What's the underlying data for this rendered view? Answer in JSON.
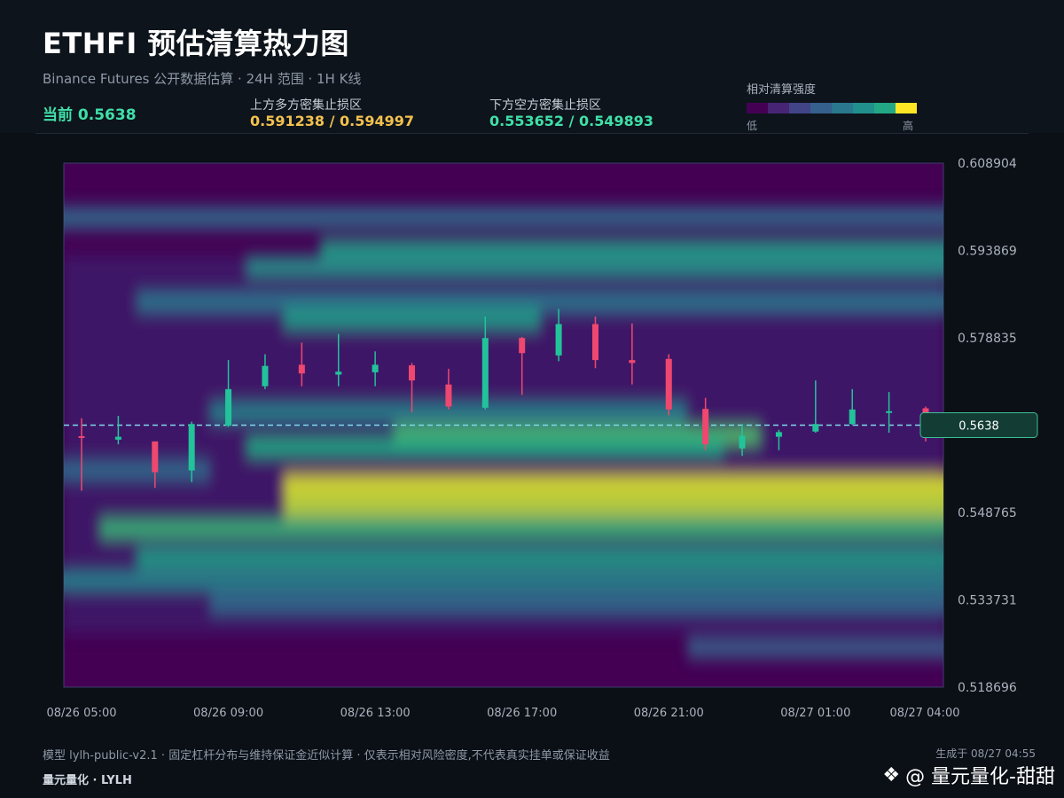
{
  "header": {
    "title": "ETHFI 预估清算热力图",
    "subtitle": "Binance Futures 公开数据估算 · 24H 范围 · 1H K线",
    "current_label": "当前",
    "current_value": "0.5638",
    "upper_zone_label": "上方多方密集止损区",
    "upper_zone_value": "0.591238 / 0.594997",
    "lower_zone_label": "下方空方密集止损区",
    "lower_zone_value": "0.553652 / 0.549893",
    "legend_title": "相对清算强度",
    "legend_low": "低",
    "legend_high": "高"
  },
  "colors": {
    "bullish": "#22c39a",
    "bearish": "#ef476f",
    "upper_zone": "#f2c14e",
    "lower_zone": "#3fe0a8",
    "legend": [
      "#440154",
      "#482475",
      "#414487",
      "#355f8d",
      "#2a788e",
      "#21908d",
      "#22a884",
      "#fde725"
    ]
  },
  "footer": {
    "note": "模型 lylh-public-v2.1 · 固定杠杆分布与维持保证金近似计算 · 仅表示相对风险密度,不代表真实挂单或保证收益",
    "brand": "量元量化 · LYLH",
    "generated": "生成于 08/27 04:55",
    "watermark": "@ 量元量化-甜甜"
  },
  "chart_data": {
    "type": "heatmap",
    "y_range": [
      0.518696,
      0.608904
    ],
    "y_ticks": [
      "0.608904",
      "0.593869",
      "0.578835",
      "0.563800",
      "0.548765",
      "0.533731",
      "0.518696"
    ],
    "x_ticks": [
      "08/26 05:00",
      "08/26 09:00",
      "08/26 13:00",
      "08/26 17:00",
      "08/26 21:00",
      "08/27 01:00",
      "08/27 04:00"
    ],
    "current_price": 0.5638,
    "current_price_label": "0.5638",
    "candles": [
      {
        "t": "08/26 05:00",
        "o": 0.5619,
        "h": 0.565,
        "l": 0.5525,
        "c": 0.5618
      },
      {
        "t": "08/26 06:00",
        "o": 0.5613,
        "h": 0.5654,
        "l": 0.5605,
        "c": 0.5618
      },
      {
        "t": "08/26 07:00",
        "o": 0.561,
        "h": 0.5608,
        "l": 0.553,
        "c": 0.5557
      },
      {
        "t": "08/26 08:00",
        "o": 0.556,
        "h": 0.5644,
        "l": 0.554,
        "c": 0.564
      },
      {
        "t": "08/26 09:00",
        "o": 0.5637,
        "h": 0.575,
        "l": 0.5635,
        "c": 0.57
      },
      {
        "t": "08/26 10:00",
        "o": 0.5705,
        "h": 0.576,
        "l": 0.57,
        "c": 0.574
      },
      {
        "t": "08/26 11:00",
        "o": 0.5742,
        "h": 0.578,
        "l": 0.5705,
        "c": 0.5727
      },
      {
        "t": "08/26 12:00",
        "o": 0.5725,
        "h": 0.5795,
        "l": 0.5705,
        "c": 0.573
      },
      {
        "t": "08/26 13:00",
        "o": 0.5729,
        "h": 0.5765,
        "l": 0.5705,
        "c": 0.5742
      },
      {
        "t": "08/26 14:00",
        "o": 0.5741,
        "h": 0.5745,
        "l": 0.566,
        "c": 0.5715
      },
      {
        "t": "08/26 15:00",
        "o": 0.5708,
        "h": 0.5735,
        "l": 0.5665,
        "c": 0.567
      },
      {
        "t": "08/26 16:00",
        "o": 0.5668,
        "h": 0.5825,
        "l": 0.5665,
        "c": 0.5788
      },
      {
        "t": "08/26 17:00",
        "o": 0.5788,
        "h": 0.579,
        "l": 0.569,
        "c": 0.5762
      },
      {
        "t": "08/26 18:00",
        "o": 0.5758,
        "h": 0.5838,
        "l": 0.5748,
        "c": 0.5812
      },
      {
        "t": "08/26 19:00",
        "o": 0.5812,
        "h": 0.5825,
        "l": 0.5736,
        "c": 0.575
      },
      {
        "t": "08/26 20:00",
        "o": 0.575,
        "h": 0.5813,
        "l": 0.5708,
        "c": 0.5745
      },
      {
        "t": "08/26 21:00",
        "o": 0.5752,
        "h": 0.576,
        "l": 0.5655,
        "c": 0.5665
      },
      {
        "t": "08/26 22:00",
        "o": 0.5666,
        "h": 0.5685,
        "l": 0.5595,
        "c": 0.5605
      },
      {
        "t": "08/26 23:00",
        "o": 0.5598,
        "h": 0.564,
        "l": 0.5585,
        "c": 0.562
      },
      {
        "t": "08/27 00:00",
        "o": 0.5618,
        "h": 0.563,
        "l": 0.5595,
        "c": 0.5626
      },
      {
        "t": "08/27 01:00",
        "o": 0.5627,
        "h": 0.5715,
        "l": 0.5625,
        "c": 0.564
      },
      {
        "t": "08/27 02:00",
        "o": 0.564,
        "h": 0.57,
        "l": 0.5638,
        "c": 0.5665
      },
      {
        "t": "08/27 03:00",
        "o": 0.566,
        "h": 0.5695,
        "l": 0.5625,
        "c": 0.5662
      },
      {
        "t": "08/27 04:00",
        "o": 0.5667,
        "h": 0.567,
        "l": 0.561,
        "c": 0.5638
      }
    ],
    "heat_bands": [
      {
        "price": 0.5995,
        "t_from": "08/26 05:00",
        "t_to": "08/27 04:00",
        "intensity": 0.35
      },
      {
        "price": 0.594,
        "t_from": "08/26 12:00",
        "t_to": "08/27 04:00",
        "intensity": 0.55
      },
      {
        "price": 0.591,
        "t_from": "08/26 10:00",
        "t_to": "08/27 04:00",
        "intensity": 0.5
      },
      {
        "price": 0.585,
        "t_from": "08/26 07:00",
        "t_to": "08/27 04:00",
        "intensity": 0.4
      },
      {
        "price": 0.582,
        "t_from": "08/26 11:00",
        "t_to": "08/26 17:00",
        "intensity": 0.55
      },
      {
        "price": 0.566,
        "t_from": "08/26 09:00",
        "t_to": "08/26 21:00",
        "intensity": 0.45
      },
      {
        "price": 0.562,
        "t_from": "08/26 14:00",
        "t_to": "08/26 23:00",
        "intensity": 0.7
      },
      {
        "price": 0.56,
        "t_from": "08/26 10:00",
        "t_to": "08/26 22:00",
        "intensity": 0.6
      },
      {
        "price": 0.556,
        "t_from": "08/26 05:00",
        "t_to": "08/26 08:00",
        "intensity": 0.35
      },
      {
        "price": 0.5536,
        "t_from": "08/26 11:00",
        "t_to": "08/27 04:00",
        "intensity": 0.95
      },
      {
        "price": 0.5499,
        "t_from": "08/26 11:00",
        "t_to": "08/27 04:00",
        "intensity": 0.9
      },
      {
        "price": 0.546,
        "t_from": "08/26 06:00",
        "t_to": "08/27 04:00",
        "intensity": 0.65
      },
      {
        "price": 0.541,
        "t_from": "08/26 07:00",
        "t_to": "08/27 04:00",
        "intensity": 0.55
      },
      {
        "price": 0.537,
        "t_from": "08/26 05:00",
        "t_to": "08/27 04:00",
        "intensity": 0.45
      },
      {
        "price": 0.533,
        "t_from": "08/26 09:00",
        "t_to": "08/27 04:00",
        "intensity": 0.35
      },
      {
        "price": 0.5255,
        "t_from": "08/26 22:00",
        "t_to": "08/27 04:00",
        "intensity": 0.3
      }
    ],
    "legend_placement": "top-right"
  }
}
